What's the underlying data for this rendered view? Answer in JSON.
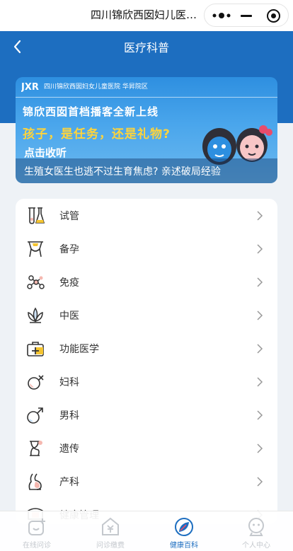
{
  "topbar": {
    "title": "四川锦欣西囡妇儿医院..."
  },
  "nav": {
    "title": "医疗科普"
  },
  "banner": {
    "hospital": "四川锦欣西囡妇女儿童医院  华昇院区",
    "headline": "锦欣西囡首档播客全新上线",
    "subhead": "孩子，是任务，还是礼物?",
    "cta": "点击收听",
    "caption": "生殖女医生也逃不过生育焦虑? 亲述破局经验"
  },
  "categories": [
    {
      "label": "试管",
      "icon": "test-tube-icon"
    },
    {
      "label": "备孕",
      "icon": "pregnancy-prep-icon"
    },
    {
      "label": "免疫",
      "icon": "immunity-icon"
    },
    {
      "label": "中医",
      "icon": "lotus-icon"
    },
    {
      "label": "功能医学",
      "icon": "medical-kit-icon"
    },
    {
      "label": "妇科",
      "icon": "female-symbol-icon"
    },
    {
      "label": "男科",
      "icon": "male-symbol-icon"
    },
    {
      "label": "遗传",
      "icon": "dna-icon"
    },
    {
      "label": "产科",
      "icon": "obstetrics-icon"
    },
    {
      "label": "健康管理",
      "icon": "health-management-icon"
    }
  ],
  "tabs": [
    {
      "label": "在线问诊",
      "icon": "online-consult-icon",
      "active": false
    },
    {
      "label": "问诊缴费",
      "icon": "payment-icon",
      "active": false
    },
    {
      "label": "健康百科",
      "icon": "encyclopedia-icon",
      "active": true
    },
    {
      "label": "个人中心",
      "icon": "profile-icon",
      "active": false
    }
  ],
  "colors": {
    "primary": "#1d6ec0",
    "accent": "#ffd43b",
    "icon_highlight": "#f4c430",
    "icon_pink": "#f5b8b0"
  }
}
